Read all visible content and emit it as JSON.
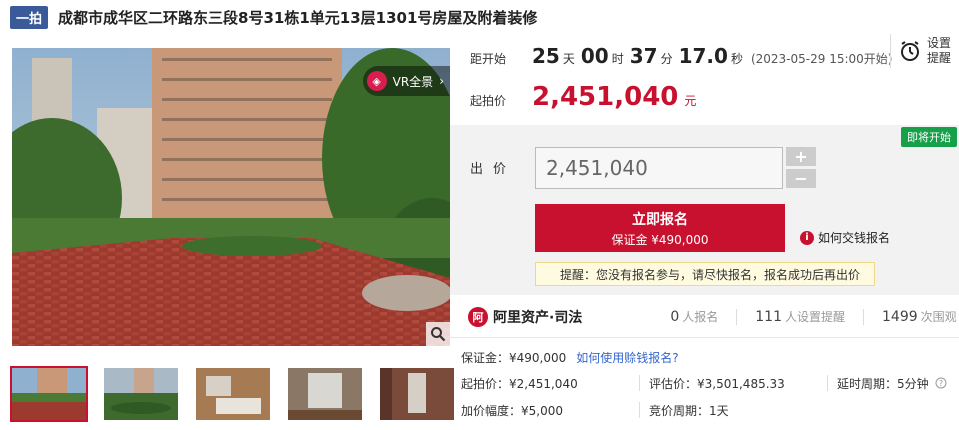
{
  "header": {
    "badge": "一拍",
    "title": "成都市成华区二环路东三段8号31栋1单元13层1301号房屋及附着装修"
  },
  "gallery": {
    "vr_label": "VR全景",
    "vr_arrow": "›",
    "thumb_count": 5
  },
  "countdown": {
    "label": "距开始",
    "days": "25",
    "days_unit": "天",
    "hours": "00",
    "hours_unit": "时",
    "minutes": "37",
    "minutes_unit": "分",
    "seconds": "17.0",
    "seconds_unit": "秒",
    "start_time": "(2023-05-29 15:00开始)"
  },
  "reminder": {
    "line1": "设置",
    "line2": "提醒"
  },
  "start_price": {
    "label": "起拍价",
    "value": "2,451,040",
    "unit": "元"
  },
  "bid": {
    "status_badge": "即将开始",
    "label": "出价",
    "value": "2,451,040",
    "plus": "+",
    "minus": "−",
    "signup_main": "立即报名",
    "signup_sub": "保证金 ¥490,000",
    "howto": "如何交钱报名",
    "tip": "提醒：您没有报名参与，请尽快报名，报名成功后再出价"
  },
  "platform": {
    "name": "阿里资产·司法",
    "signups": "0",
    "signups_label": "人报名",
    "reminders": "111",
    "reminders_label": "人设置提醒",
    "views": "1499",
    "views_label": "次围观"
  },
  "details": {
    "deposit": "保证金：¥490,000",
    "deposit_link": "如何使用赊钱报名?",
    "start_price": "起拍价：¥2,451,040",
    "valuation": "评估价：¥3,501,485.33",
    "extension": "延时周期：5分钟",
    "extension_icon": "help-circle-icon",
    "increment": "加价幅度：¥5,000",
    "bid_period": "竞价周期：1天"
  },
  "colors": {
    "accent": "#c8112e",
    "badge_blue": "#3a5a9a",
    "soon_green": "#17a04a",
    "link_blue": "#3366cc"
  }
}
